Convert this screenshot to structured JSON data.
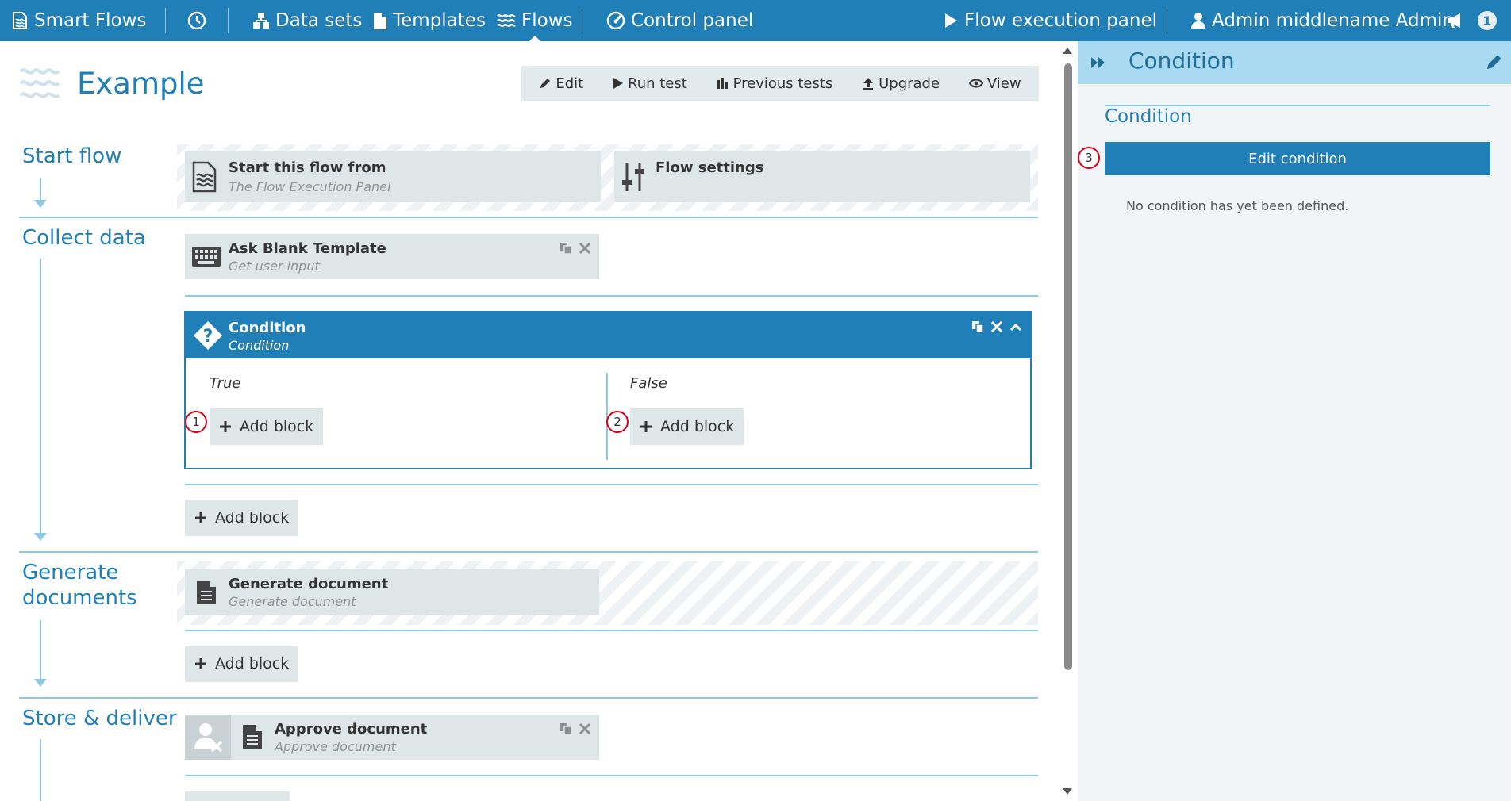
{
  "topbar": {
    "brand": "Smart Flows",
    "nav": {
      "datasets": "Data sets",
      "templates": "Templates",
      "flows": "Flows",
      "control_panel": "Control panel",
      "flow_execution_panel": "Flow execution panel",
      "user": "Admin middlename Admin",
      "notification_count": "1"
    }
  },
  "flow": {
    "name": "Example",
    "actions": {
      "edit": "Edit",
      "run_test": "Run test",
      "previous_tests": "Previous tests",
      "upgrade": "Upgrade",
      "view": "View"
    }
  },
  "stages": {
    "start": {
      "title": "Start flow",
      "start_block": {
        "title": "Start this flow from",
        "subtitle": "The Flow Execution Panel"
      },
      "settings_block": {
        "title": "Flow settings"
      }
    },
    "collect": {
      "title": "Collect data",
      "ask_block": {
        "title": "Ask Blank Template",
        "subtitle": "Get user input"
      },
      "condition": {
        "title": "Condition",
        "subtitle": "Condition",
        "true_label": "True",
        "false_label": "False",
        "add_block_label": "Add block"
      },
      "add_block_label": "Add block"
    },
    "generate": {
      "title_line1": "Generate",
      "title_line2": "documents",
      "generate_block": {
        "title": "Generate document",
        "subtitle": "Generate document"
      },
      "add_block_label": "Add block"
    },
    "store": {
      "title": "Store & deliver",
      "approve_block": {
        "title": "Approve document",
        "subtitle": "Approve document"
      }
    }
  },
  "markers": {
    "one": "1",
    "two": "2",
    "three": "3"
  },
  "panel": {
    "title": "Condition",
    "section_title": "Condition",
    "edit_button": "Edit condition",
    "empty_message": "No condition has yet been defined."
  },
  "icons": {
    "brand": "flow-logo-icon",
    "history": "clock-icon",
    "datasets": "sitemap-icon",
    "templates": "file-icon",
    "flows": "waves-icon",
    "control_panel": "gauge-icon",
    "execution": "play-icon",
    "user": "user-icon",
    "notifications": "megaphone-icon"
  },
  "colors": {
    "primary": "#1f7fb6",
    "panel_header": "#a9daf1",
    "block_bg": "#dfe6e8",
    "marker": "#d9001b"
  }
}
